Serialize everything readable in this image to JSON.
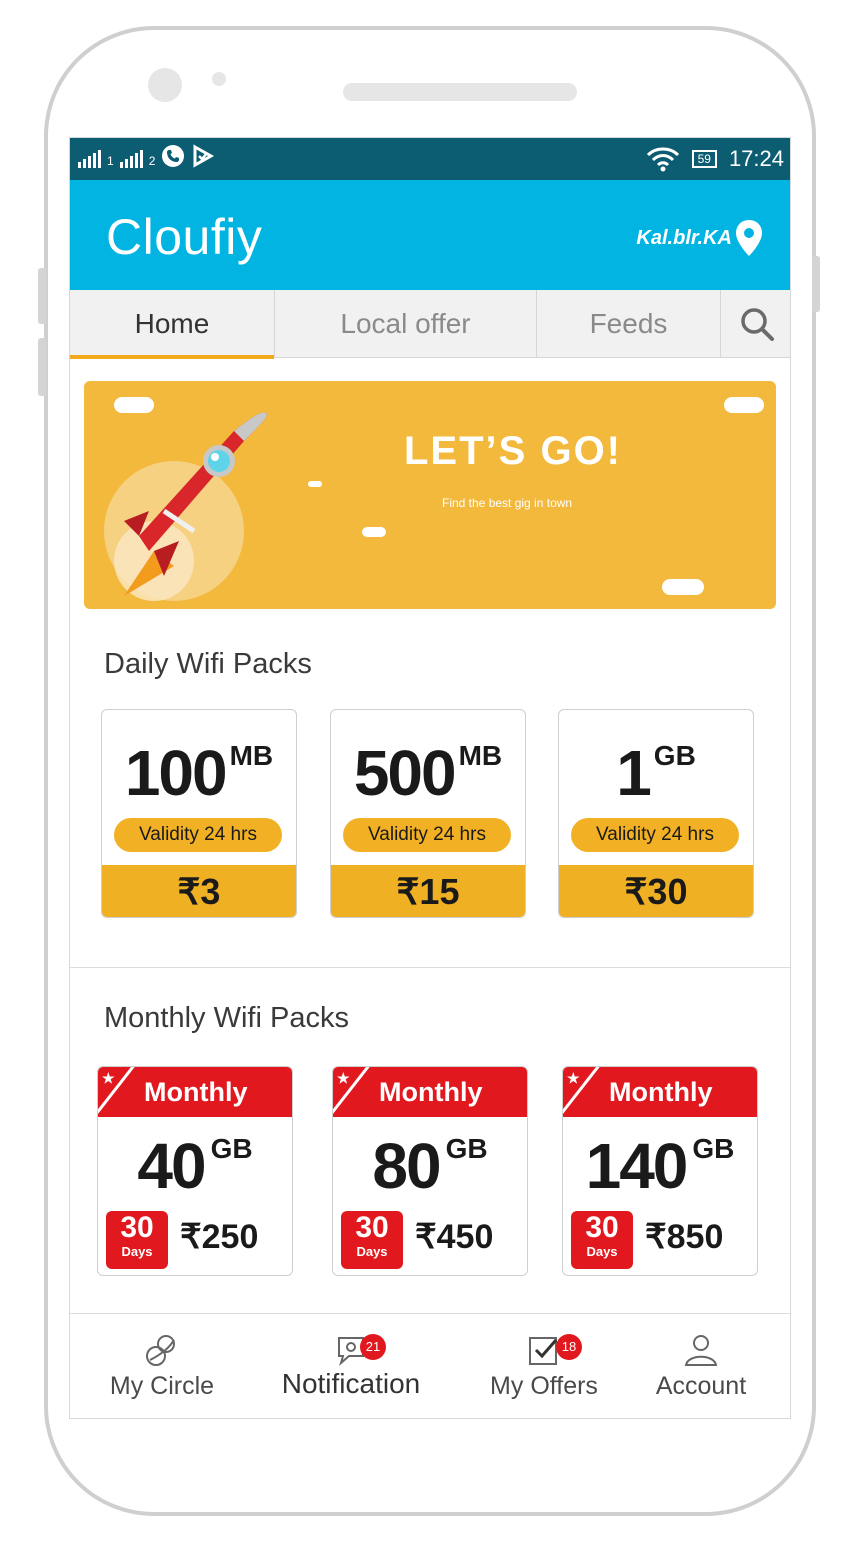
{
  "status_bar": {
    "sim1": "1",
    "sim2": "2",
    "battery": "59",
    "time": "17:24"
  },
  "app": {
    "title": "Cloufiy",
    "location": "Kal.blr.KA"
  },
  "tabs": [
    {
      "label": "Home",
      "active": true
    },
    {
      "label": "Local offer",
      "active": false
    },
    {
      "label": "Feeds",
      "active": false
    }
  ],
  "banner": {
    "title": "LET’S GO!",
    "subtitle": "Find the best gig in town"
  },
  "daily": {
    "title": "Daily Wifi Packs",
    "packs": [
      {
        "size": "100",
        "unit": "MB",
        "validity": "Validity 24 hrs",
        "price": "₹3"
      },
      {
        "size": "500",
        "unit": "MB",
        "validity": "Validity 24 hrs",
        "price": "₹15"
      },
      {
        "size": "1",
        "unit": "GB",
        "validity": "Validity 24 hrs",
        "price": "₹30"
      }
    ]
  },
  "monthly": {
    "title": "Monthly Wifi Packs",
    "packs": [
      {
        "label": "Monthly",
        "size": "40",
        "unit": "GB",
        "days": "30",
        "days_label": "Days",
        "price": "₹250"
      },
      {
        "label": "Monthly",
        "size": "80",
        "unit": "GB",
        "days": "30",
        "days_label": "Days",
        "price": "₹450"
      },
      {
        "label": "Monthly",
        "size": "140",
        "unit": "GB",
        "days": "30",
        "days_label": "Days",
        "price": "₹850"
      }
    ]
  },
  "bottom_nav": [
    {
      "label": "My Circle",
      "icon": "circle-icon"
    },
    {
      "label": "Notification",
      "icon": "notification-icon",
      "badge": "21"
    },
    {
      "label": "My Offers",
      "icon": "offers-icon",
      "badge": "18"
    },
    {
      "label": "Account",
      "icon": "account-icon"
    }
  ],
  "colors": {
    "status_bar": "#0d5d72",
    "app_bar": "#01b4e2",
    "accent": "#f0b023",
    "monthly_red": "#e1191f"
  }
}
